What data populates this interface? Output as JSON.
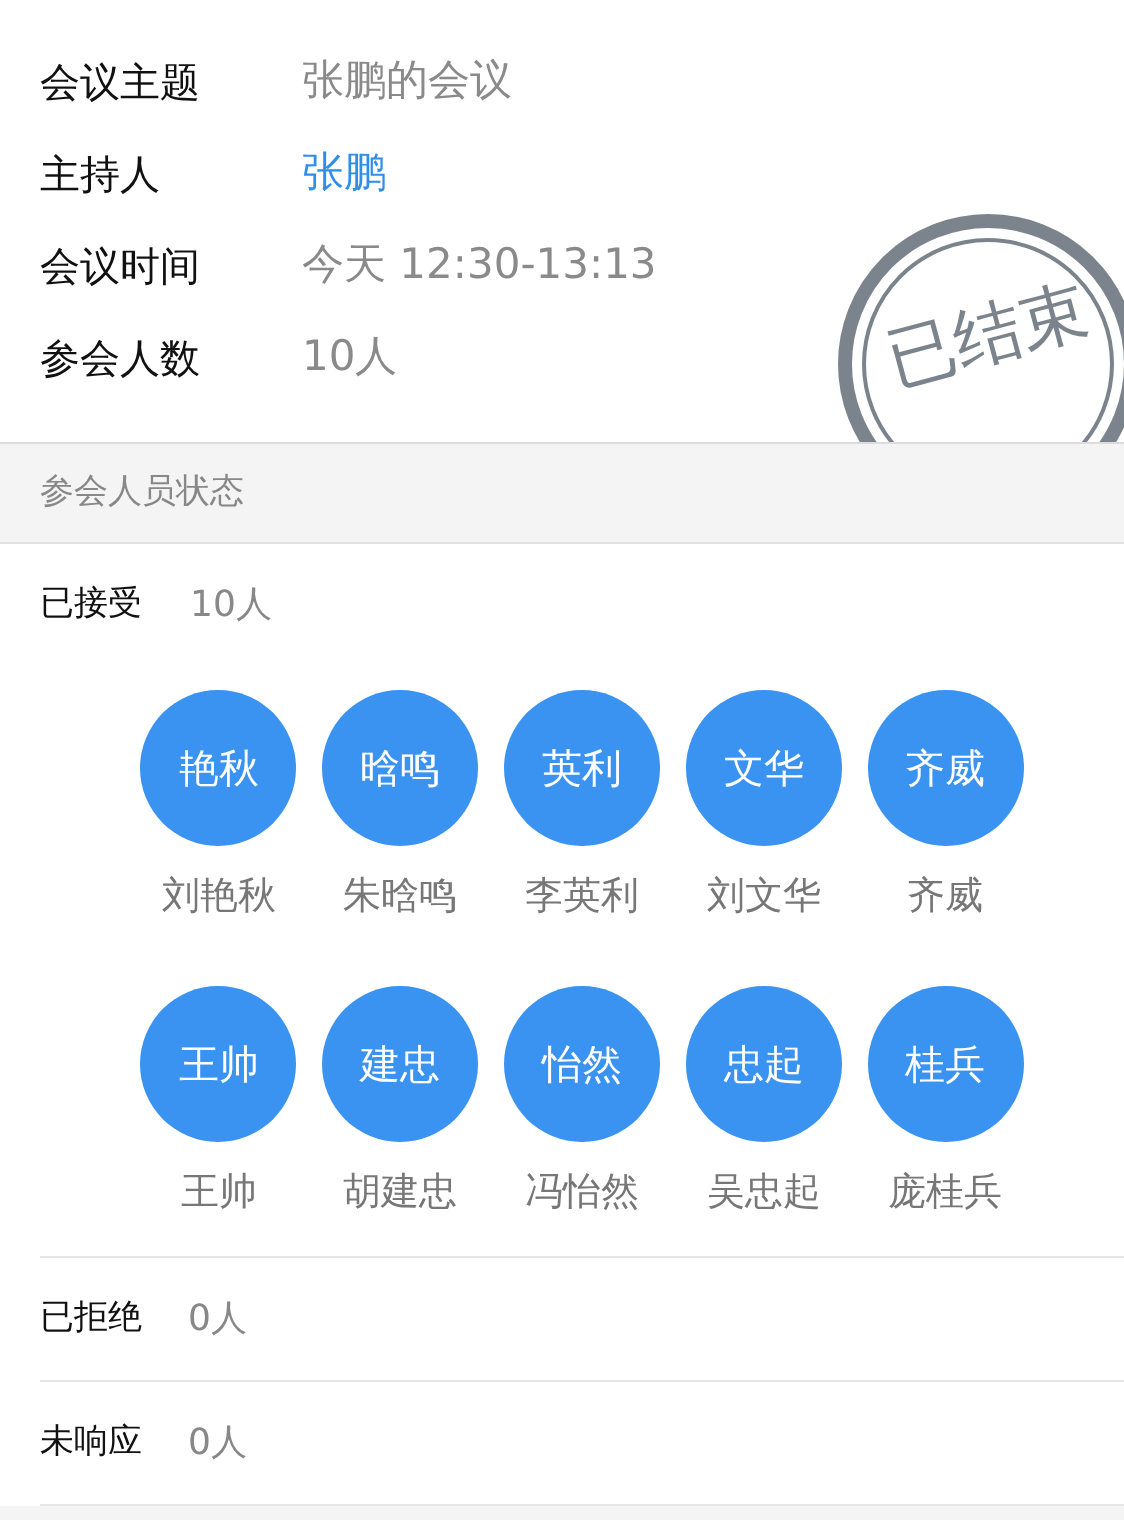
{
  "meeting_info": [
    {
      "label": "会议主题",
      "value": "张鹏的会议",
      "kind": "text"
    },
    {
      "label": "主持人",
      "value": "张鹏",
      "kind": "link"
    },
    {
      "label": "会议时间",
      "value": "今天 12:30-13:13",
      "kind": "text"
    },
    {
      "label": "参会人数",
      "value": "10人",
      "kind": "text"
    }
  ],
  "stamp": "已结束",
  "section_header": "参会人员状态",
  "accepted": {
    "label": "已接受",
    "count": "10人",
    "attendees": [
      {
        "avatar": "艳秋",
        "name": "刘艳秋"
      },
      {
        "avatar": "晗鸣",
        "name": "朱晗鸣"
      },
      {
        "avatar": "英利",
        "name": "李英利"
      },
      {
        "avatar": "文华",
        "name": "刘文华"
      },
      {
        "avatar": "齐威",
        "name": "齐威"
      },
      {
        "avatar": "王帅",
        "name": "王帅"
      },
      {
        "avatar": "建忠",
        "name": "胡建忠"
      },
      {
        "avatar": "怡然",
        "name": "冯怡然"
      },
      {
        "avatar": "忠起",
        "name": "吴忠起"
      },
      {
        "avatar": "桂兵",
        "name": "庞桂兵"
      }
    ]
  },
  "other_statuses": [
    {
      "label": "已拒绝",
      "count": "0人"
    },
    {
      "label": "未响应",
      "count": "0人"
    }
  ]
}
